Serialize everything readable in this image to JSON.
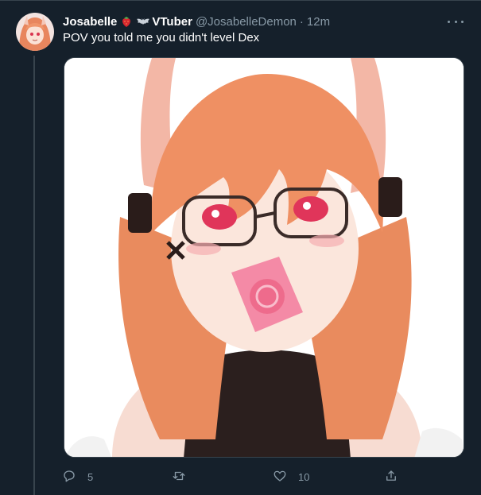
{
  "tweet": {
    "author": {
      "display_name": "Josabelle",
      "suffix": "VTuber",
      "handle": "@JosabelleDemon",
      "separator": "·",
      "timestamp": "12m",
      "emoji": [
        "strawberry-emoji",
        "bat-emoji"
      ]
    },
    "text": "POV you told me you didn't level Dex",
    "media": {
      "description": "anime-vtuber-illustration"
    },
    "actions": {
      "replies": "5",
      "retweets": "",
      "likes": "10"
    }
  },
  "colors": {
    "background": "#15202b",
    "border": "#38444d",
    "secondary_text": "#8899a6",
    "primary_text": "#ffffff"
  }
}
